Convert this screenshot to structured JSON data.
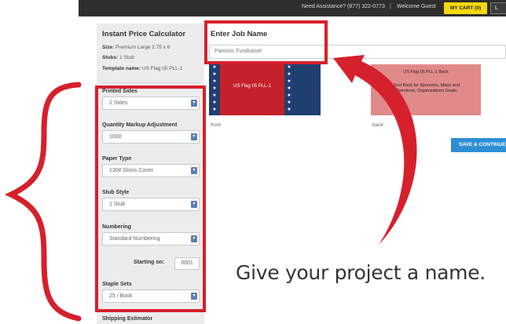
{
  "topbar": {
    "assistance": "Need Assistance? (877) 322-0773",
    "separator": "|",
    "welcome": "Welcome Guest",
    "cart_label": "MY CART (0)",
    "login_label": "L"
  },
  "calculator": {
    "title": "Instant Price Calculator",
    "size_label": "Size:",
    "size_value": "Premium Large 2.75 x 6",
    "stubs_label": "Stubs:",
    "stubs_value": "1 Stub",
    "template_label": "Template name:",
    "template_value": "US Flag 05 PLL-1",
    "fields": [
      {
        "label": "Printed Sides",
        "value": "2 Sides"
      },
      {
        "label": "Quantity Markup Adjustment",
        "value": "1000"
      },
      {
        "label": "Paper Type",
        "value": "130# Gloss Cover"
      },
      {
        "label": "Stub Style",
        "value": "1 Stub"
      },
      {
        "label": "Numbering",
        "value": "Standard Numbering"
      },
      {
        "label": "Staple Sets",
        "value": "25 / Book"
      }
    ],
    "starting_on_label": "Starting on:",
    "starting_on_value": "0001",
    "shipping_label": "Shipping Estimator"
  },
  "job": {
    "title": "Enter Job Name",
    "name_value": "Patriotic Fundraiser"
  },
  "preview": {
    "front_text": "US Flag 05 PLL-1",
    "front_caption": "front",
    "back_title": "US Flag 05 PLL-1 Back",
    "back_body": "Text Back for Sponsors, Maps and Directions, Organizations Goals.",
    "back_caption": "back"
  },
  "save_button": "SAVE & CONTINUE",
  "annotation": {
    "caption": "Give your project a name.",
    "highlight_color": "#d6202b"
  }
}
